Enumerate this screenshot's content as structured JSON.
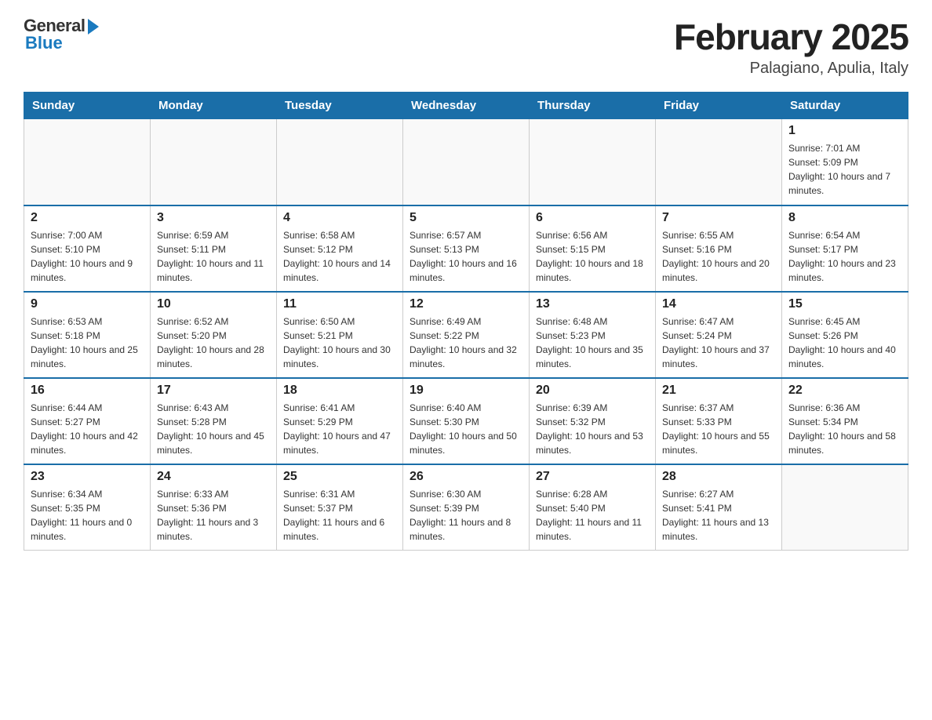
{
  "logo": {
    "general": "General",
    "blue": "Blue"
  },
  "title": "February 2025",
  "subtitle": "Palagiano, Apulia, Italy",
  "weekdays": [
    "Sunday",
    "Monday",
    "Tuesday",
    "Wednesday",
    "Thursday",
    "Friday",
    "Saturday"
  ],
  "weeks": [
    [
      {
        "day": "",
        "info": ""
      },
      {
        "day": "",
        "info": ""
      },
      {
        "day": "",
        "info": ""
      },
      {
        "day": "",
        "info": ""
      },
      {
        "day": "",
        "info": ""
      },
      {
        "day": "",
        "info": ""
      },
      {
        "day": "1",
        "info": "Sunrise: 7:01 AM\nSunset: 5:09 PM\nDaylight: 10 hours and 7 minutes."
      }
    ],
    [
      {
        "day": "2",
        "info": "Sunrise: 7:00 AM\nSunset: 5:10 PM\nDaylight: 10 hours and 9 minutes."
      },
      {
        "day": "3",
        "info": "Sunrise: 6:59 AM\nSunset: 5:11 PM\nDaylight: 10 hours and 11 minutes."
      },
      {
        "day": "4",
        "info": "Sunrise: 6:58 AM\nSunset: 5:12 PM\nDaylight: 10 hours and 14 minutes."
      },
      {
        "day": "5",
        "info": "Sunrise: 6:57 AM\nSunset: 5:13 PM\nDaylight: 10 hours and 16 minutes."
      },
      {
        "day": "6",
        "info": "Sunrise: 6:56 AM\nSunset: 5:15 PM\nDaylight: 10 hours and 18 minutes."
      },
      {
        "day": "7",
        "info": "Sunrise: 6:55 AM\nSunset: 5:16 PM\nDaylight: 10 hours and 20 minutes."
      },
      {
        "day": "8",
        "info": "Sunrise: 6:54 AM\nSunset: 5:17 PM\nDaylight: 10 hours and 23 minutes."
      }
    ],
    [
      {
        "day": "9",
        "info": "Sunrise: 6:53 AM\nSunset: 5:18 PM\nDaylight: 10 hours and 25 minutes."
      },
      {
        "day": "10",
        "info": "Sunrise: 6:52 AM\nSunset: 5:20 PM\nDaylight: 10 hours and 28 minutes."
      },
      {
        "day": "11",
        "info": "Sunrise: 6:50 AM\nSunset: 5:21 PM\nDaylight: 10 hours and 30 minutes."
      },
      {
        "day": "12",
        "info": "Sunrise: 6:49 AM\nSunset: 5:22 PM\nDaylight: 10 hours and 32 minutes."
      },
      {
        "day": "13",
        "info": "Sunrise: 6:48 AM\nSunset: 5:23 PM\nDaylight: 10 hours and 35 minutes."
      },
      {
        "day": "14",
        "info": "Sunrise: 6:47 AM\nSunset: 5:24 PM\nDaylight: 10 hours and 37 minutes."
      },
      {
        "day": "15",
        "info": "Sunrise: 6:45 AM\nSunset: 5:26 PM\nDaylight: 10 hours and 40 minutes."
      }
    ],
    [
      {
        "day": "16",
        "info": "Sunrise: 6:44 AM\nSunset: 5:27 PM\nDaylight: 10 hours and 42 minutes."
      },
      {
        "day": "17",
        "info": "Sunrise: 6:43 AM\nSunset: 5:28 PM\nDaylight: 10 hours and 45 minutes."
      },
      {
        "day": "18",
        "info": "Sunrise: 6:41 AM\nSunset: 5:29 PM\nDaylight: 10 hours and 47 minutes."
      },
      {
        "day": "19",
        "info": "Sunrise: 6:40 AM\nSunset: 5:30 PM\nDaylight: 10 hours and 50 minutes."
      },
      {
        "day": "20",
        "info": "Sunrise: 6:39 AM\nSunset: 5:32 PM\nDaylight: 10 hours and 53 minutes."
      },
      {
        "day": "21",
        "info": "Sunrise: 6:37 AM\nSunset: 5:33 PM\nDaylight: 10 hours and 55 minutes."
      },
      {
        "day": "22",
        "info": "Sunrise: 6:36 AM\nSunset: 5:34 PM\nDaylight: 10 hours and 58 minutes."
      }
    ],
    [
      {
        "day": "23",
        "info": "Sunrise: 6:34 AM\nSunset: 5:35 PM\nDaylight: 11 hours and 0 minutes."
      },
      {
        "day": "24",
        "info": "Sunrise: 6:33 AM\nSunset: 5:36 PM\nDaylight: 11 hours and 3 minutes."
      },
      {
        "day": "25",
        "info": "Sunrise: 6:31 AM\nSunset: 5:37 PM\nDaylight: 11 hours and 6 minutes."
      },
      {
        "day": "26",
        "info": "Sunrise: 6:30 AM\nSunset: 5:39 PM\nDaylight: 11 hours and 8 minutes."
      },
      {
        "day": "27",
        "info": "Sunrise: 6:28 AM\nSunset: 5:40 PM\nDaylight: 11 hours and 11 minutes."
      },
      {
        "day": "28",
        "info": "Sunrise: 6:27 AM\nSunset: 5:41 PM\nDaylight: 11 hours and 13 minutes."
      },
      {
        "day": "",
        "info": ""
      }
    ]
  ]
}
